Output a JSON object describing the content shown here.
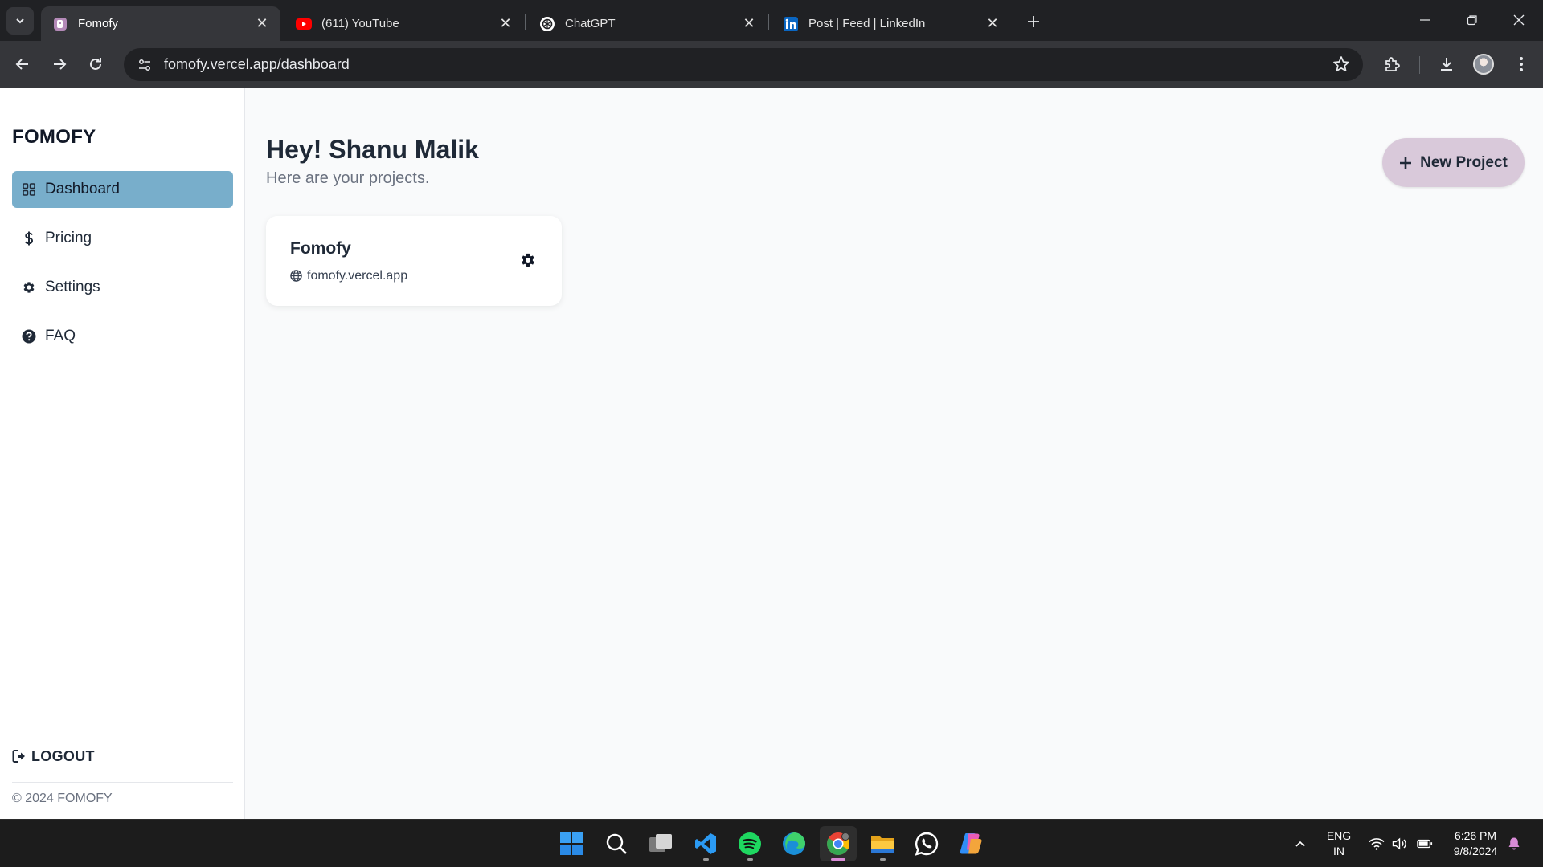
{
  "browser": {
    "tabs": [
      {
        "title": "Fomofy",
        "favicon": "fomofy-icon",
        "active": true
      },
      {
        "title": "(611) YouTube",
        "favicon": "youtube-icon",
        "active": false
      },
      {
        "title": "ChatGPT",
        "favicon": "chatgpt-icon",
        "active": false
      },
      {
        "title": "Post | Feed | LinkedIn",
        "favicon": "linkedin-icon",
        "active": false
      }
    ],
    "url": "fomofy.vercel.app/dashboard"
  },
  "sidebar": {
    "brand": "FOMOFY",
    "items": [
      {
        "label": "Dashboard",
        "icon": "grid-icon",
        "active": true
      },
      {
        "label": "Pricing",
        "icon": "dollar-icon",
        "active": false
      },
      {
        "label": "Settings",
        "icon": "gear-icon",
        "active": false
      },
      {
        "label": "FAQ",
        "icon": "question-circle-icon",
        "active": false
      }
    ],
    "logout_label": "LOGOUT",
    "copyright": "© 2024 FOMOFY"
  },
  "main": {
    "greeting": "Hey! Shanu Malik",
    "subtitle": "Here are your projects.",
    "new_project_label": "New Project",
    "projects": [
      {
        "name": "Fomofy",
        "domain": "fomofy.vercel.app"
      }
    ]
  },
  "taskbar": {
    "apps": [
      "windows-start",
      "search",
      "task-view",
      "vscode",
      "spotify",
      "edge",
      "chrome",
      "file-explorer",
      "whatsapp",
      "copilot"
    ],
    "language_line1": "ENG",
    "language_line2": "IN",
    "time": "6:26 PM",
    "date": "9/8/2024"
  },
  "colors": {
    "active_nav_bg": "#78aecb",
    "new_project_bg": "#d9c9da",
    "browser_tabbar": "#202124",
    "browser_toolbar": "#35363a"
  }
}
